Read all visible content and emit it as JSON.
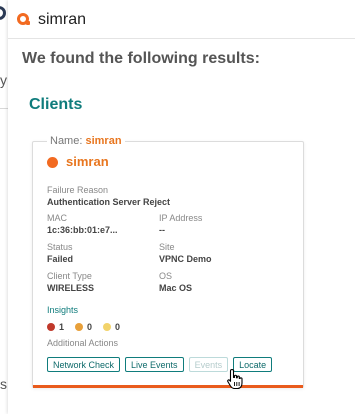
{
  "search": {
    "value": "simran"
  },
  "results_heading": "We found the following results:",
  "section_title": "Clients",
  "card": {
    "legend_label": "Name:",
    "legend_value": "simran",
    "client_name": "simran",
    "fields": {
      "failure_reason": {
        "label": "Failure Reason",
        "value": "Authentication Server Reject"
      },
      "mac": {
        "label": "MAC",
        "value": "1c:36:bb:01:e7..."
      },
      "ip_address": {
        "label": "IP Address",
        "value": "--"
      },
      "status": {
        "label": "Status",
        "value": "Failed"
      },
      "site": {
        "label": "Site",
        "value": "VPNC Demo"
      },
      "client_type": {
        "label": "Client Type",
        "value": "WIRELESS"
      },
      "os": {
        "label": "OS",
        "value": "Mac OS"
      }
    },
    "insights_label": "Insights",
    "insights": [
      {
        "count": "1",
        "color": "#c0392b"
      },
      {
        "count": "0",
        "color": "#e8a03a"
      },
      {
        "count": "0",
        "color": "#f2d36b"
      }
    ],
    "additional_actions_label": "Additional Actions",
    "actions": {
      "network_check": "Network Check",
      "live_events": "Live Events",
      "events": "Events",
      "locate": "Locate"
    }
  },
  "background_fragments": {
    "frag_y": "y",
    "frag_s": "s"
  },
  "colors": {
    "brand_orange": "#f26a21",
    "teal": "#0f7c7c",
    "card_bottom_bar": "#e95b1c"
  },
  "icons": {
    "search_logo": "aruba-logo-icon",
    "cursor": "hand-pointer-icon"
  }
}
